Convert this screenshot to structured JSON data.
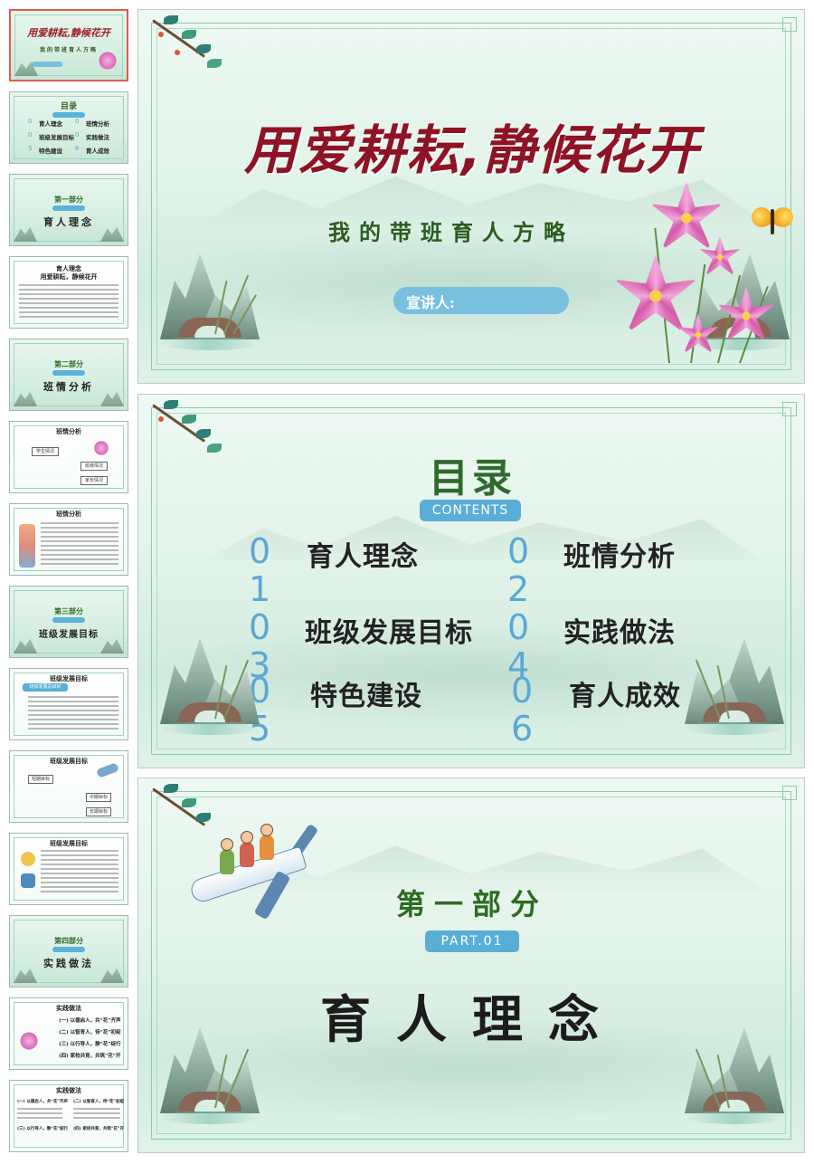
{
  "thumbnails": [
    {
      "kind": "title",
      "title": "用爱耕耘,静候花开",
      "subtitle": "我的带班育人方略",
      "active": true
    },
    {
      "kind": "toc",
      "title": "目录",
      "items": [
        "育人理念",
        "班情分析",
        "班级发展目标",
        "实践做法",
        "特色建设",
        "育人成效"
      ]
    },
    {
      "kind": "section",
      "part": "第一部分",
      "name": "育人理念"
    },
    {
      "kind": "text",
      "title": "育人理念",
      "subtitle": "用爱耕耘，静候花开"
    },
    {
      "kind": "section",
      "part": "第二部分",
      "name": "班情分析"
    },
    {
      "kind": "diagram",
      "title": "班情分析",
      "boxes": [
        "学生情况",
        "班级情况",
        "家长情况"
      ]
    },
    {
      "kind": "text",
      "title": "班情分析"
    },
    {
      "kind": "section",
      "part": "第三部分",
      "name": "班级发展目标"
    },
    {
      "kind": "text",
      "title": "班级发展目标",
      "subtitle": "班级发展总目标"
    },
    {
      "kind": "diagram",
      "title": "班级发展目标",
      "boxes": [
        "短期目标",
        "中期目标",
        "长期目标"
      ]
    },
    {
      "kind": "text",
      "title": "班级发展目标"
    },
    {
      "kind": "section",
      "part": "第四部分",
      "name": "实践做法"
    },
    {
      "kind": "list",
      "title": "实践做法",
      "items": [
        "(一) 以德启人，共“花”齐声",
        "(二) 以智育人，待“花”初绽",
        "(三) 以行导人，静“花”绽行",
        "(四) 家校共育，共筑“花”开"
      ]
    },
    {
      "kind": "list",
      "title": "实践做法",
      "items": [
        "(一) 以德启人，共“花”齐声",
        "(二) 以智育人，待“花”初绽",
        "(三) 以行导人，静“花”绽行",
        "(四) 家校共育，共筑“花”开"
      ]
    }
  ],
  "slide1": {
    "title": "用爱耕耘,静候花开",
    "subtitle": "我的带班育人方略",
    "presenter_label": "宣讲人:"
  },
  "slide2": {
    "title": "目录",
    "contents_label": "CONTENTS",
    "items": [
      {
        "num": "0\n1",
        "label": "育人理念"
      },
      {
        "num": "0\n2",
        "label": "班情分析"
      },
      {
        "num": "0\n3",
        "label": "班级发展目标"
      },
      {
        "num": "0\n4",
        "label": "实践做法"
      },
      {
        "num": "0\n5",
        "label": "特色建设"
      },
      {
        "num": "0\n6",
        "label": "育人成效"
      }
    ]
  },
  "slide3": {
    "part": "第一部分",
    "part_en": "PART.01",
    "name": "育人理念"
  },
  "colors": {
    "title_red": "#8e1324",
    "green": "#2f6a2c",
    "accent_blue": "#5aaed6",
    "active_border": "#e25b4f"
  }
}
